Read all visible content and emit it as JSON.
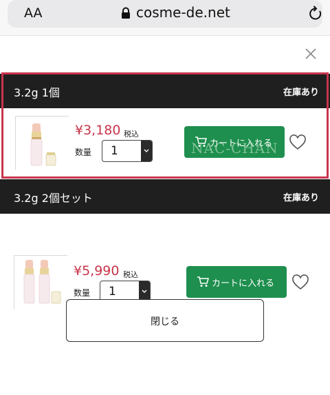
{
  "browser": {
    "text_size_label": "AA",
    "url": "cosme-de.net"
  },
  "variants": [
    {
      "name": "3.2g 1個",
      "stock": "在庫あり",
      "price": "¥3,180",
      "tax_label": "税込",
      "qty_label": "数量",
      "qty_value": "1",
      "cart_label": "カートに入れる",
      "selected": true
    },
    {
      "name": "3.2g 2個セット",
      "stock": "在庫あり",
      "price": "¥5,990",
      "tax_label": "税込",
      "qty_label": "数量",
      "qty_value": "1",
      "cart_label": "カートに入れる",
      "selected": false
    }
  ],
  "watermark": "NAC-CHAN",
  "close_button_label": "閉じる",
  "colors": {
    "header_bg": "#1f1f1f",
    "price": "#c8354a",
    "cart_button": "#1e8f4e",
    "selection_frame": "#c9354d"
  },
  "icons": [
    "lock-icon",
    "reload-icon",
    "close-icon",
    "cart-icon",
    "heart-icon",
    "chevron-down-icon",
    "lip-product-image"
  ]
}
